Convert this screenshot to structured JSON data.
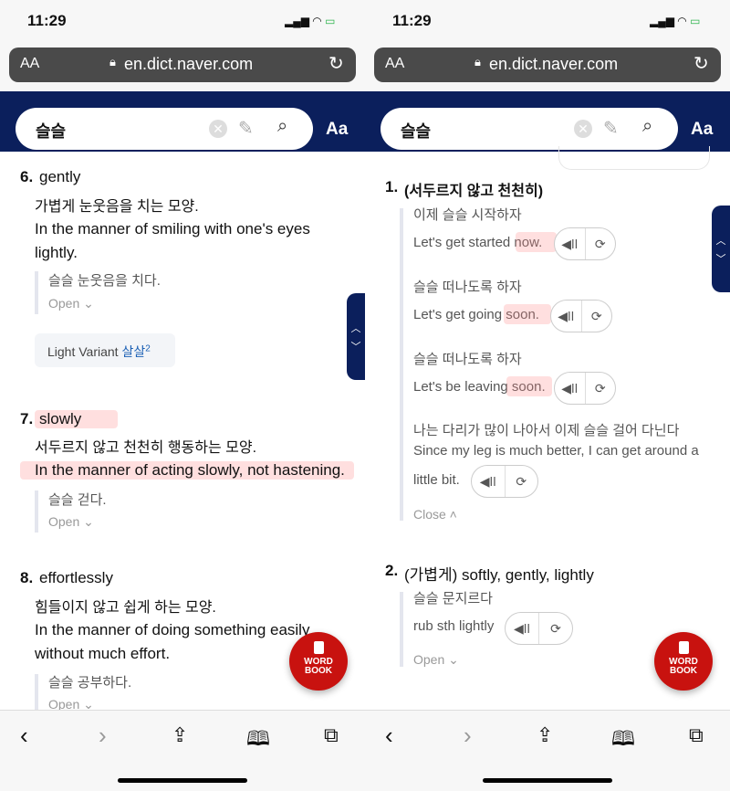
{
  "status": {
    "time": "11:29"
  },
  "browser": {
    "aa": "AA",
    "url": "en.dict.naver.com",
    "back": "‹",
    "forward": "›"
  },
  "search": {
    "query": "슬슬",
    "font_btn": "Aa"
  },
  "word_book": {
    "line1": "WORD",
    "line2": "BOOK"
  },
  "colors": {
    "navy": "#0b1f5c",
    "wordbook": "#c8120f",
    "highlight": "#ffb0b0"
  },
  "left": {
    "senses": [
      {
        "num": "6.",
        "word": "gently",
        "ko": "가볍게 눈웃음을 치는 모양.",
        "en1": "In the manner of smiling with one's eyes",
        "en2": "lightly.",
        "example": "슬슬 눈웃음을 치다.",
        "toggle": "Open"
      },
      {
        "num": "7.",
        "word": "slowly",
        "ko": "서두르지 않고 천천히 행동하는 모양.",
        "en1": "In the manner of acting slowly, not hastening.",
        "example": "슬슬 걷다.",
        "toggle": "Open"
      },
      {
        "num": "8.",
        "word": "effortlessly",
        "ko": "힘들이지 않고 쉽게 하는 모양.",
        "en1": "In the manner of doing something easily",
        "en2": "without much effort.",
        "example": "슬슬 공부하다.",
        "toggle": "Open"
      }
    ],
    "variant": {
      "label": "Light Variant",
      "word": "살살",
      "sup": "2"
    }
  },
  "right": {
    "senses": [
      {
        "num": "1.",
        "title": "(서두르지 않고 천천히)",
        "examples": [
          {
            "ko": "이제 슬슬 시작하자",
            "en": "Let's get started now."
          },
          {
            "ko": "슬슬 떠나도록 하자",
            "en": "Let's get going soon."
          },
          {
            "ko": "슬슬 떠나도록 하자",
            "en": "Let's be leaving soon."
          },
          {
            "ko": "나는 다리가 많이 나아서 이제 슬슬 걸어 다닌다",
            "en": "Since my leg is much better, I can get around a",
            "en2": "little bit."
          }
        ],
        "toggle": "Close"
      },
      {
        "num": "2.",
        "title": "(가볍게) softly, gently, lightly",
        "examples": [
          {
            "ko": "슬슬 문지르다",
            "en": "rub sth lightly"
          }
        ],
        "toggle": "Open"
      }
    ]
  }
}
